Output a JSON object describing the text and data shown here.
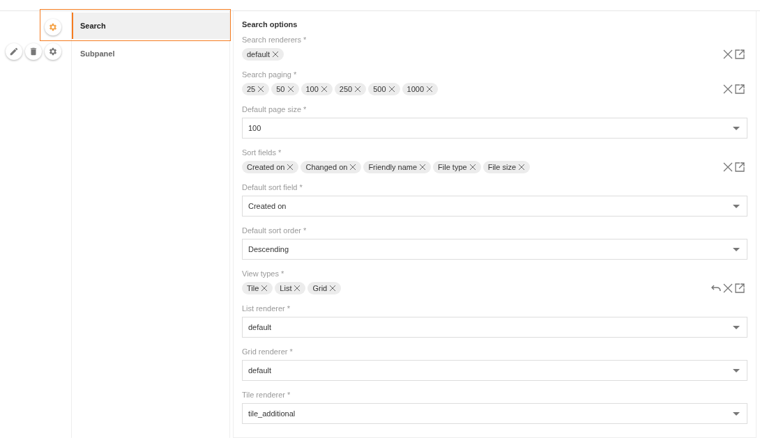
{
  "nav": {
    "items": [
      {
        "label": "Search",
        "selected": true
      },
      {
        "label": "Subpanel",
        "selected": false
      }
    ]
  },
  "panel": {
    "title": "Search options",
    "fields": [
      {
        "kind": "tags",
        "label": "Search renderers *",
        "tags": [
          "default"
        ],
        "undo": false
      },
      {
        "kind": "tags",
        "label": "Search paging *",
        "tags": [
          "25",
          "50",
          "100",
          "250",
          "500",
          "1000"
        ],
        "undo": false
      },
      {
        "kind": "select",
        "label": "Default page size *",
        "value": "100"
      },
      {
        "kind": "tags",
        "label": "Sort fields *",
        "tags": [
          "Created on",
          "Changed on",
          "Friendly name",
          "File type",
          "File size"
        ],
        "undo": false
      },
      {
        "kind": "select",
        "label": "Default sort field *",
        "value": "Created on"
      },
      {
        "kind": "select",
        "label": "Default sort order *",
        "value": "Descending"
      },
      {
        "kind": "tags",
        "label": "View types *",
        "tags": [
          "Tile",
          "List",
          "Grid"
        ],
        "undo": true
      },
      {
        "kind": "select",
        "label": "List renderer *",
        "value": "default"
      },
      {
        "kind": "select",
        "label": "Grid renderer *",
        "value": "default"
      },
      {
        "kind": "select",
        "label": "Tile renderer *",
        "value": "tile_additional"
      }
    ]
  }
}
